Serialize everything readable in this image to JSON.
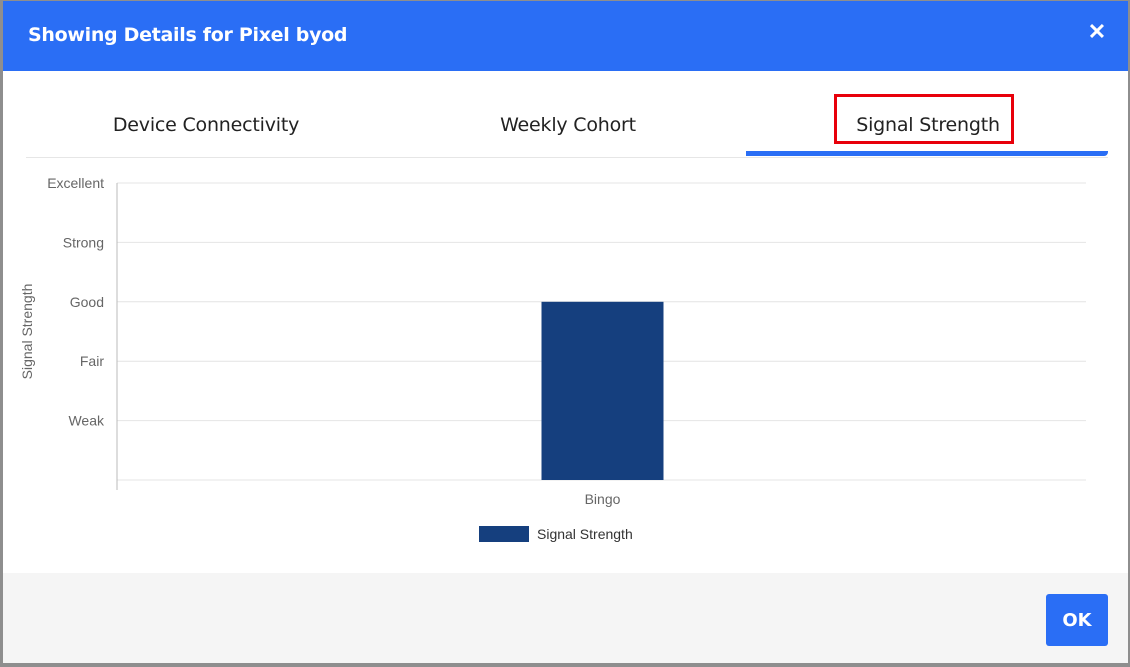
{
  "modal": {
    "title": "Showing Details for Pixel byod",
    "close_icon": "close-icon",
    "ok_label": "OK"
  },
  "tabs": [
    {
      "label": "Device Connectivity",
      "active": false
    },
    {
      "label": "Weekly Cohort",
      "active": false
    },
    {
      "label": "Signal Strength",
      "active": true
    }
  ],
  "colors": {
    "accent": "#2a6ef5",
    "bar": "#153f7e",
    "highlight": "#e8000a"
  },
  "chart_data": {
    "type": "bar",
    "categories": [
      "Bingo"
    ],
    "y_levels": [
      "Weak",
      "Fair",
      "Good",
      "Strong",
      "Excellent"
    ],
    "series": [
      {
        "name": "Signal Strength",
        "values": [
          "Good"
        ]
      }
    ],
    "ylabel": "Signal Strength",
    "xlabel": "",
    "grid": true,
    "legend_position": "bottom"
  }
}
